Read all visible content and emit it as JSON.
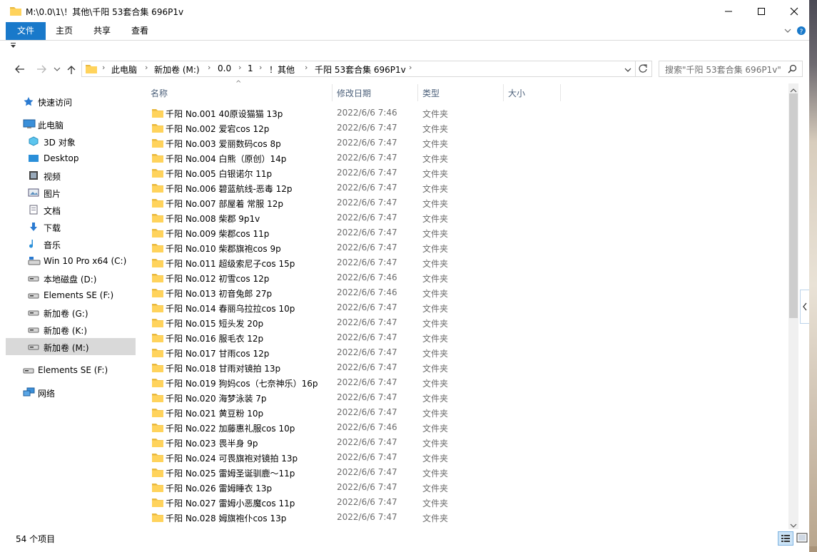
{
  "window": {
    "title": "M:\\0.0\\1\\！其他\\千阳 53套合集 696P1v"
  },
  "ribbon": {
    "tabs": [
      "文件",
      "主页",
      "共享",
      "查看"
    ]
  },
  "address": {
    "crumbs": [
      "此电脑",
      "新加卷 (M:)",
      "0.0",
      "1",
      "！其他",
      "千阳 53套合集 696P1v"
    ]
  },
  "search": {
    "placeholder": "搜索\"千阳 53套合集 696P1v\""
  },
  "nav": {
    "quick_access": "快速访问",
    "this_pc": "此电脑",
    "items": [
      {
        "label": "3D 对象",
        "icon": "3d-objects-icon"
      },
      {
        "label": "Desktop",
        "icon": "desktop-icon"
      },
      {
        "label": "视频",
        "icon": "video-icon"
      },
      {
        "label": "图片",
        "icon": "pictures-icon"
      },
      {
        "label": "文档",
        "icon": "documents-icon"
      },
      {
        "label": "下载",
        "icon": "download-icon"
      },
      {
        "label": "音乐",
        "icon": "music-icon"
      },
      {
        "label": "Win 10 Pro x64 (C:)",
        "icon": "system-drive-icon"
      },
      {
        "label": "本地磁盘 (D:)",
        "icon": "drive-icon"
      },
      {
        "label": "Elements SE (F:)",
        "icon": "drive-icon"
      },
      {
        "label": "新加卷 (G:)",
        "icon": "drive-icon"
      },
      {
        "label": "新加卷 (K:)",
        "icon": "drive-icon"
      },
      {
        "label": "新加卷 (M:)",
        "icon": "drive-icon",
        "selected": true
      }
    ],
    "external": "Elements SE (F:)",
    "network": "网络"
  },
  "columns": {
    "name": "名称",
    "date": "修改日期",
    "type": "类型",
    "size": "大小"
  },
  "files": [
    {
      "name": "千阳 No.001 40原设猫猫 13p",
      "date": "2022/6/6 7:46",
      "type": "文件夹"
    },
    {
      "name": "千阳 No.002 爱宕cos 12p",
      "date": "2022/6/6 7:47",
      "type": "文件夹"
    },
    {
      "name": "千阳 No.003 爱丽数码cos 8p",
      "date": "2022/6/6 7:47",
      "type": "文件夹"
    },
    {
      "name": "千阳 No.004 白熊（原创）14p",
      "date": "2022/6/6 7:47",
      "type": "文件夹"
    },
    {
      "name": "千阳 No.005 白银诺尔 11p",
      "date": "2022/6/6 7:47",
      "type": "文件夹"
    },
    {
      "name": "千阳 No.006 碧蓝航线-恶毒 12p",
      "date": "2022/6/6 7:47",
      "type": "文件夹"
    },
    {
      "name": "千阳 No.007 部屋着 常服 12p",
      "date": "2022/6/6 7:47",
      "type": "文件夹"
    },
    {
      "name": "千阳 No.008 柴郡 9p1v",
      "date": "2022/6/6 7:47",
      "type": "文件夹"
    },
    {
      "name": "千阳 No.009 柴郡cos 11p",
      "date": "2022/6/6 7:47",
      "type": "文件夹"
    },
    {
      "name": "千阳 No.010 柴郡旗袍cos 9p",
      "date": "2022/6/6 7:47",
      "type": "文件夹"
    },
    {
      "name": "千阳 No.011 超级索尼子cos 15p",
      "date": "2022/6/6 7:47",
      "type": "文件夹"
    },
    {
      "name": "千阳 No.012 初雪cos 12p",
      "date": "2022/6/6 7:46",
      "type": "文件夹"
    },
    {
      "name": "千阳 No.013 初音兔郎 27p",
      "date": "2022/6/6 7:46",
      "type": "文件夹"
    },
    {
      "name": "千阳 No.014 春丽乌拉拉cos 10p",
      "date": "2022/6/6 7:47",
      "type": "文件夹"
    },
    {
      "name": "千阳 No.015 短头发 20p",
      "date": "2022/6/6 7:47",
      "type": "文件夹"
    },
    {
      "name": "千阳 No.016 服毛衣 12p",
      "date": "2022/6/6 7:47",
      "type": "文件夹"
    },
    {
      "name": "千阳 No.017 甘雨cos 12p",
      "date": "2022/6/6 7:47",
      "type": "文件夹"
    },
    {
      "name": "千阳 No.018 甘雨对镜拍 13p",
      "date": "2022/6/6 7:47",
      "type": "文件夹"
    },
    {
      "name": "千阳 No.019 狗妈cos（七奈神乐）16p",
      "date": "2022/6/6 7:47",
      "type": "文件夹"
    },
    {
      "name": "千阳 No.020 海梦泳装 7p",
      "date": "2022/6/6 7:47",
      "type": "文件夹"
    },
    {
      "name": "千阳 No.021 黄豆粉 10p",
      "date": "2022/6/6 7:47",
      "type": "文件夹"
    },
    {
      "name": "千阳 No.022 加藤惠礼服cos 10p",
      "date": "2022/6/6 7:46",
      "type": "文件夹"
    },
    {
      "name": "千阳 No.023 畏半身 9p",
      "date": "2022/6/6 7:47",
      "type": "文件夹"
    },
    {
      "name": "千阳 No.024 可畏旗袍对镜拍 13p",
      "date": "2022/6/6 7:47",
      "type": "文件夹"
    },
    {
      "name": "千阳 No.025 雷姆圣诞驯鹿～11p",
      "date": "2022/6/6 7:47",
      "type": "文件夹"
    },
    {
      "name": "千阳 No.026 雷姆睡衣 13p",
      "date": "2022/6/6 7:47",
      "type": "文件夹"
    },
    {
      "name": "千阳 No.027 雷姆小恶魔cos 11p",
      "date": "2022/6/6 7:47",
      "type": "文件夹"
    },
    {
      "name": "千阳 No.028 姆旗袍仆cos 13p",
      "date": "2022/6/6 7:47",
      "type": "文件夹"
    }
  ],
  "status": {
    "count": "54 个项目"
  },
  "colors": {
    "accent": "#1979ca",
    "folder": "#ffd35c",
    "selected_nav": "#d9d9d9"
  }
}
